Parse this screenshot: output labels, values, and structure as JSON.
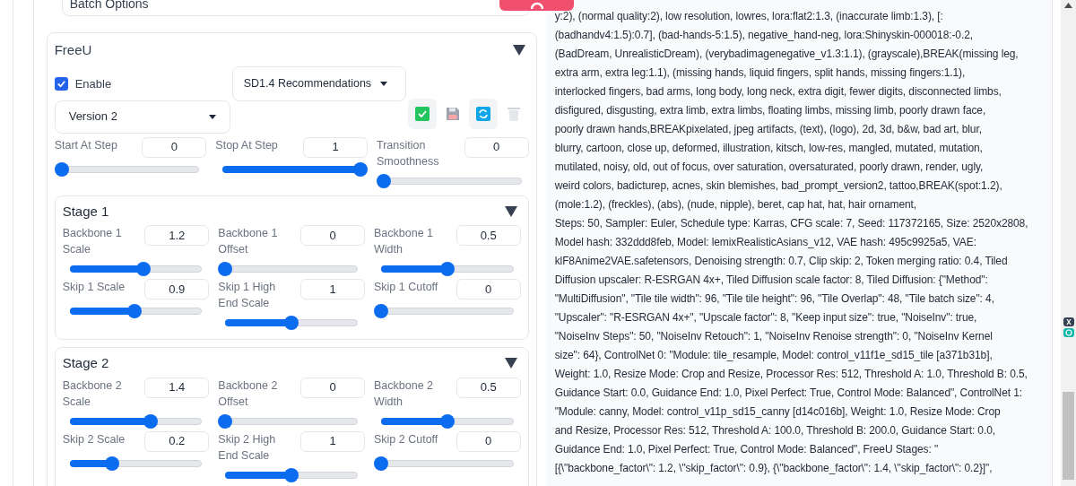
{
  "batch_options": {
    "title": "Batch Options"
  },
  "freeu": {
    "title": "FreeU",
    "expanded": true,
    "enable": {
      "label": "Enable",
      "checked": true
    },
    "preset": "SD1.4 Recommendations",
    "version": "Version 2",
    "params": [
      {
        "label": "Start At Step",
        "value": "0",
        "level": 0
      },
      {
        "label": "Stop At Step",
        "value": "1",
        "level": 1
      },
      {
        "label": "Transition Smoothness",
        "value": "0",
        "level": 0
      }
    ],
    "stages": [
      {
        "title": "Stage 1",
        "expanded": true,
        "params": [
          {
            "label": "Backbone 1 Scale",
            "value": "1.2",
            "level": 0.56
          },
          {
            "label": "Backbone 1 Offset",
            "value": "0",
            "level": 0
          },
          {
            "label": "Backbone 1 Width",
            "value": "0.5",
            "level": 0.5
          },
          {
            "label": "Skip 1 Scale",
            "value": "0.9",
            "level": 0.49
          },
          {
            "label": "Skip 1 High End Scale",
            "value": "1",
            "level": 0.5
          },
          {
            "label": "Skip 1 Cutoff",
            "value": "0",
            "level": 0
          }
        ]
      },
      {
        "title": "Stage 2",
        "expanded": true,
        "params": [
          {
            "label": "Backbone 2 Scale",
            "value": "1.4",
            "level": 0.61
          },
          {
            "label": "Backbone 2 Offset",
            "value": "0",
            "level": 0
          },
          {
            "label": "Backbone 2 Width",
            "value": "0.5",
            "level": 0.5
          },
          {
            "label": "Skip 2 Scale",
            "value": "0.2",
            "level": 0.32
          },
          {
            "label": "Skip 2 High End Scale",
            "value": "1",
            "level": 0.5
          },
          {
            "label": "Skip 2 Cutoff",
            "value": "0",
            "level": 0
          }
        ]
      }
    ]
  },
  "parameters_text": [
    "y:2), (normal quality:2), low resolution, lowres, lora:flat2:1.3, (inaccurate limb:1.3), [:",
    "(badhandv4:1.5):0.7], (bad-hands-5:1.5), negative_hand-neg, lora:Shinyskin-000018:-0.2,",
    "(BadDream, UnrealisticDream), (verybadimagenegative_v1.3:1.1), (grayscale),BREAK(missing leg,",
    "extra arm, extra leg:1.1), (missing hands, liquid fingers, split hands, missing fingers:1.1),",
    "interlocked fingers, bad arms, long body, long neck, extra digit, fewer digits, disconnected limbs,",
    "disfigured, disgusting, extra limb, extra limbs, floating limbs, missing limb, poorly drawn face,",
    "poorly drawn hands,BREAKpixelated, jpeg artifacts, (text), (logo), 2d, 3d, b&w, bad art, blur,",
    "blurry, cartoon, close up, deformed, illustration, kitsch, low-res, mangled, mutated, mutation,",
    "mutilated, noisy, old, out of focus, over saturation, oversaturated, poorly drawn, render, ugly,",
    "weird colors, badicturep, acnes, skin blemishes, bad_prompt_version2, tattoo,BREAK(spot:1.2),",
    "(mole:1.2), (freckles), (abs), (nude, nipple), beret, cap hat, hat, hair ornament,",
    "Steps: 50, Sampler: Euler, Schedule type: Karras, CFG scale: 7, Seed: 117372165, Size: 2520x2808,",
    "Model hash: 332ddd8feb, Model: lemixRealisticAsians_v12, VAE hash: 495c9925a5, VAE:",
    "klF8Anime2VAE.safetensors, Denoising strength: 0.7, Clip skip: 2, Token merging ratio: 0.4, Tiled",
    "Diffusion upscaler: R-ESRGAN 4x+, Tiled Diffusion scale factor: 8, Tiled Diffusion: {\"Method\":",
    "\"MultiDiffusion\", \"Tile tile width\": 96, \"Tile tile height\": 96, \"Tile Overlap\": 48, \"Tile batch size\": 4,",
    "\"Upscaler\": \"R-ESRGAN 4x+\", \"Upscale factor\": 8, \"Keep input size\": true, \"NoiseInv\": true,",
    "\"NoiseInv Steps\": 50, \"NoiseInv Retouch\": 1, \"NoiseInv Renoise strength\": 0, \"NoiseInv Kernel",
    "size\": 64}, ControlNet 0: \"Module: tile_resample, Model: control_v11f1e_sd15_tile [a371b31b],",
    "Weight: 1.0, Resize Mode: Crop and Resize, Processor Res: 512, Threshold A: 1.0, Threshold B: 0.5,",
    "Guidance Start: 0.0, Guidance End: 1.0, Pixel Perfect: True, Control Mode: Balanced\", ControlNet 1:",
    "\"Module: canny, Model: control_v11p_sd15_canny [d14c016b], Weight: 1.0, Resize Mode: Crop",
    "and Resize, Processor Res: 512, Threshold A: 100.0, Threshold B: 200.0, Guidance Start: 0.0,",
    "Guidance End: 1.0, Pixel Perfect: True, Control Mode: Balanced\", FreeU Stages: \"",
    "[{\\\"backbone_factor\\\": 1.2, \\\"skip_factor\\\": 0.9}, {\\\"backbone_factor\\\": 1.4, \\\"skip_factor\\\": 0.2}]\","
  ]
}
